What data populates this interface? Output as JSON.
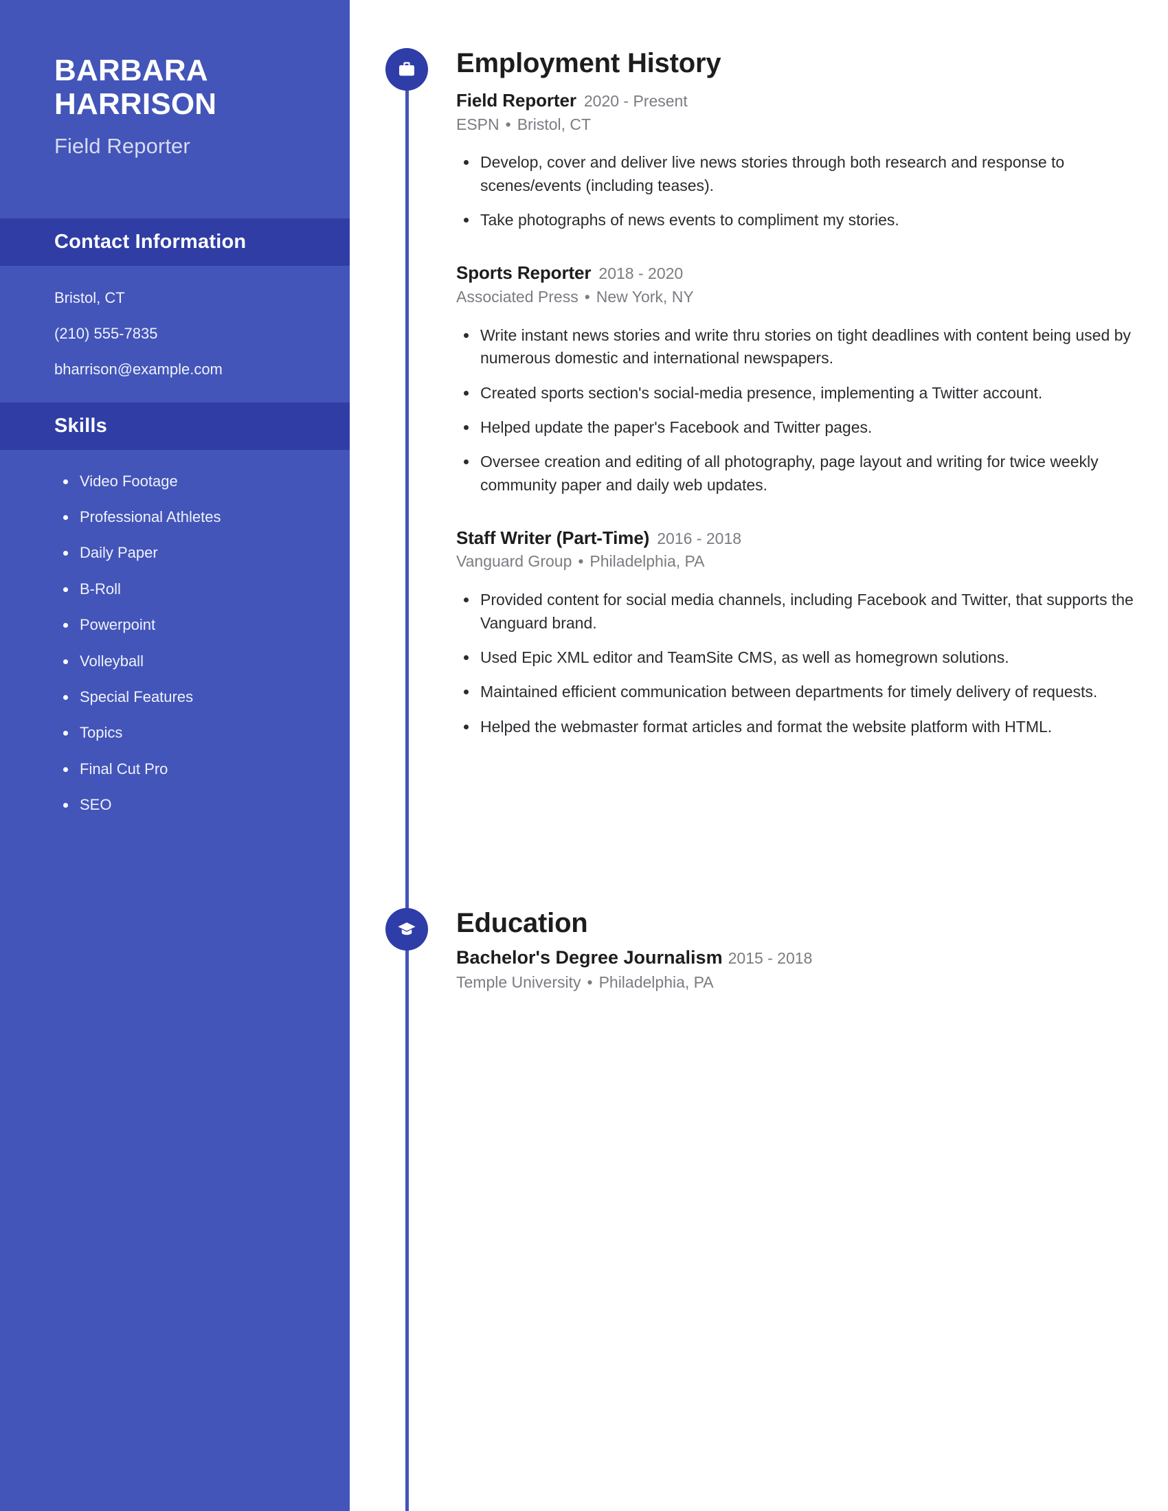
{
  "theme": {
    "sidebar_bg": "#4355b9",
    "sidebar_band_bg": "#2f3da5",
    "badge_bg": "#2f3da8",
    "timeline_color": "#4355b9",
    "text_dark": "#1d1d1f",
    "text_muted": "#7b7b82"
  },
  "sidebar": {
    "name_first": "BARBARA",
    "name_last": "HARRISON",
    "job_title": "Field Reporter",
    "contact": {
      "heading": "Contact Information",
      "items": [
        "Bristol, CT",
        "(210) 555-7835",
        "bharrison@example.com"
      ]
    },
    "skills": {
      "heading": "Skills",
      "items": [
        "Video Footage",
        "Professional Athletes",
        "Daily Paper",
        "B-Roll",
        "Powerpoint",
        "Volleyball",
        "Special Features",
        "Topics",
        "Final Cut Pro",
        "SEO"
      ]
    }
  },
  "main": {
    "employment": {
      "heading": "Employment History",
      "icon": "briefcase-icon",
      "entries": [
        {
          "title": "Field Reporter",
          "dates": "2020 - Present",
          "company": "ESPN",
          "separator": "•",
          "location": "Bristol, CT",
          "bullets": [
            "Develop, cover and deliver live news stories through both research and response to scenes/events (including teases).",
            "Take photographs of news events to compliment my stories."
          ]
        },
        {
          "title": "Sports Reporter",
          "dates": "2018 - 2020",
          "company": "Associated Press",
          "separator": "•",
          "location": "New York, NY",
          "bullets": [
            "Write instant news stories and write thru stories on tight deadlines with content being used by numerous domestic and international newspapers.",
            "Created sports section's social-media presence, implementing a Twitter account.",
            "Helped update the paper's Facebook and Twitter pages.",
            "Oversee creation and editing of all photography, page layout and writing for twice weekly community paper and daily web updates."
          ]
        },
        {
          "title": "Staff Writer (Part-Time)",
          "dates": "2016 - 2018",
          "company": "Vanguard Group",
          "separator": "•",
          "location": "Philadelphia, PA",
          "bullets": [
            "Provided content for social media channels, including Facebook and Twitter, that supports the Vanguard brand.",
            "Used Epic XML editor and TeamSite CMS, as well as homegrown solutions.",
            "Maintained efficient communication between departments for timely delivery of requests.",
            "Helped the webmaster format articles and format the website platform with HTML."
          ]
        }
      ]
    },
    "education": {
      "heading": "Education",
      "icon": "graduation-cap-icon",
      "entries": [
        {
          "degree": "Bachelor's Degree Journalism",
          "dates": "2015 - 2018",
          "school": "Temple University",
          "separator": "•",
          "location": "Philadelphia, PA"
        }
      ]
    }
  }
}
